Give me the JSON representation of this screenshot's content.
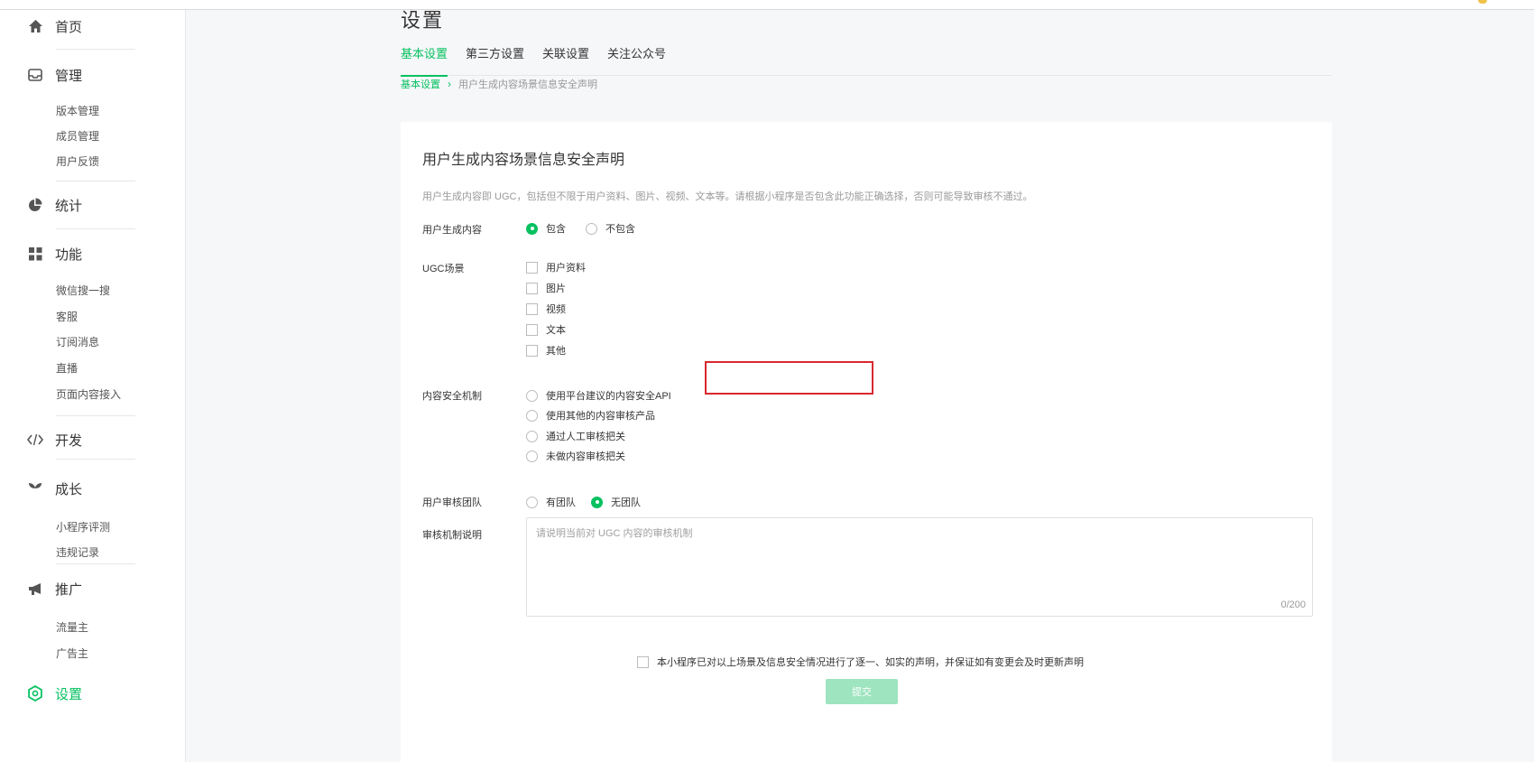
{
  "sidebar": {
    "home": "首页",
    "manage": {
      "label": "管理",
      "items": [
        "版本管理",
        "成员管理",
        "用户反馈"
      ]
    },
    "stats": "统计",
    "features": {
      "label": "功能",
      "items": [
        "微信搜一搜",
        "客服",
        "订阅消息",
        "直播",
        "页面内容接入"
      ]
    },
    "dev": "开发",
    "growth": {
      "label": "成长",
      "items": [
        "小程序评测",
        "违规记录"
      ]
    },
    "promote": {
      "label": "推广",
      "items": [
        "流量主",
        "广告主"
      ]
    },
    "settings": "设置"
  },
  "page": {
    "title": "设置",
    "tabs": [
      "基本设置",
      "第三方设置",
      "关联设置",
      "关注公众号"
    ],
    "breadcrumb": {
      "root": "基本设置",
      "sep": "›",
      "current": "用户生成内容场景信息安全声明"
    }
  },
  "form": {
    "title": "用户生成内容场景信息安全声明",
    "description": "用户生成内容即 UGC，包括但不限于用户资料、图片、视频、文本等。请根据小程序是否包含此功能正确选择，否则可能导致审核不通过。",
    "ugc_content": {
      "label": "用户生成内容",
      "options": [
        "包含",
        "不包含"
      ],
      "selected": "包含"
    },
    "ugc_scenes": {
      "label": "UGC场景",
      "options": [
        "用户资料",
        "图片",
        "视频",
        "文本",
        "其他"
      ]
    },
    "security": {
      "label": "内容安全机制",
      "options": [
        "使用平台建议的内容安全API",
        "使用其他的内容审核产品",
        "通过人工审核把关",
        "未做内容审核把关"
      ]
    },
    "team": {
      "label": "用户审核团队",
      "options": [
        "有团队",
        "无团队"
      ],
      "selected": "无团队"
    },
    "review_desc": {
      "label": "审核机制说明",
      "placeholder": "请说明当前对 UGC 内容的审核机制",
      "counter": "0/200"
    },
    "agreement": "本小程序已对以上场景及信息安全情况进行了逐一、如实的声明，并保证如有变更会及时更新声明",
    "submit": "提交"
  },
  "colors": {
    "accent": "#07c160",
    "highlight": "#d9282f",
    "submit_disabled": "#9de4bf"
  }
}
